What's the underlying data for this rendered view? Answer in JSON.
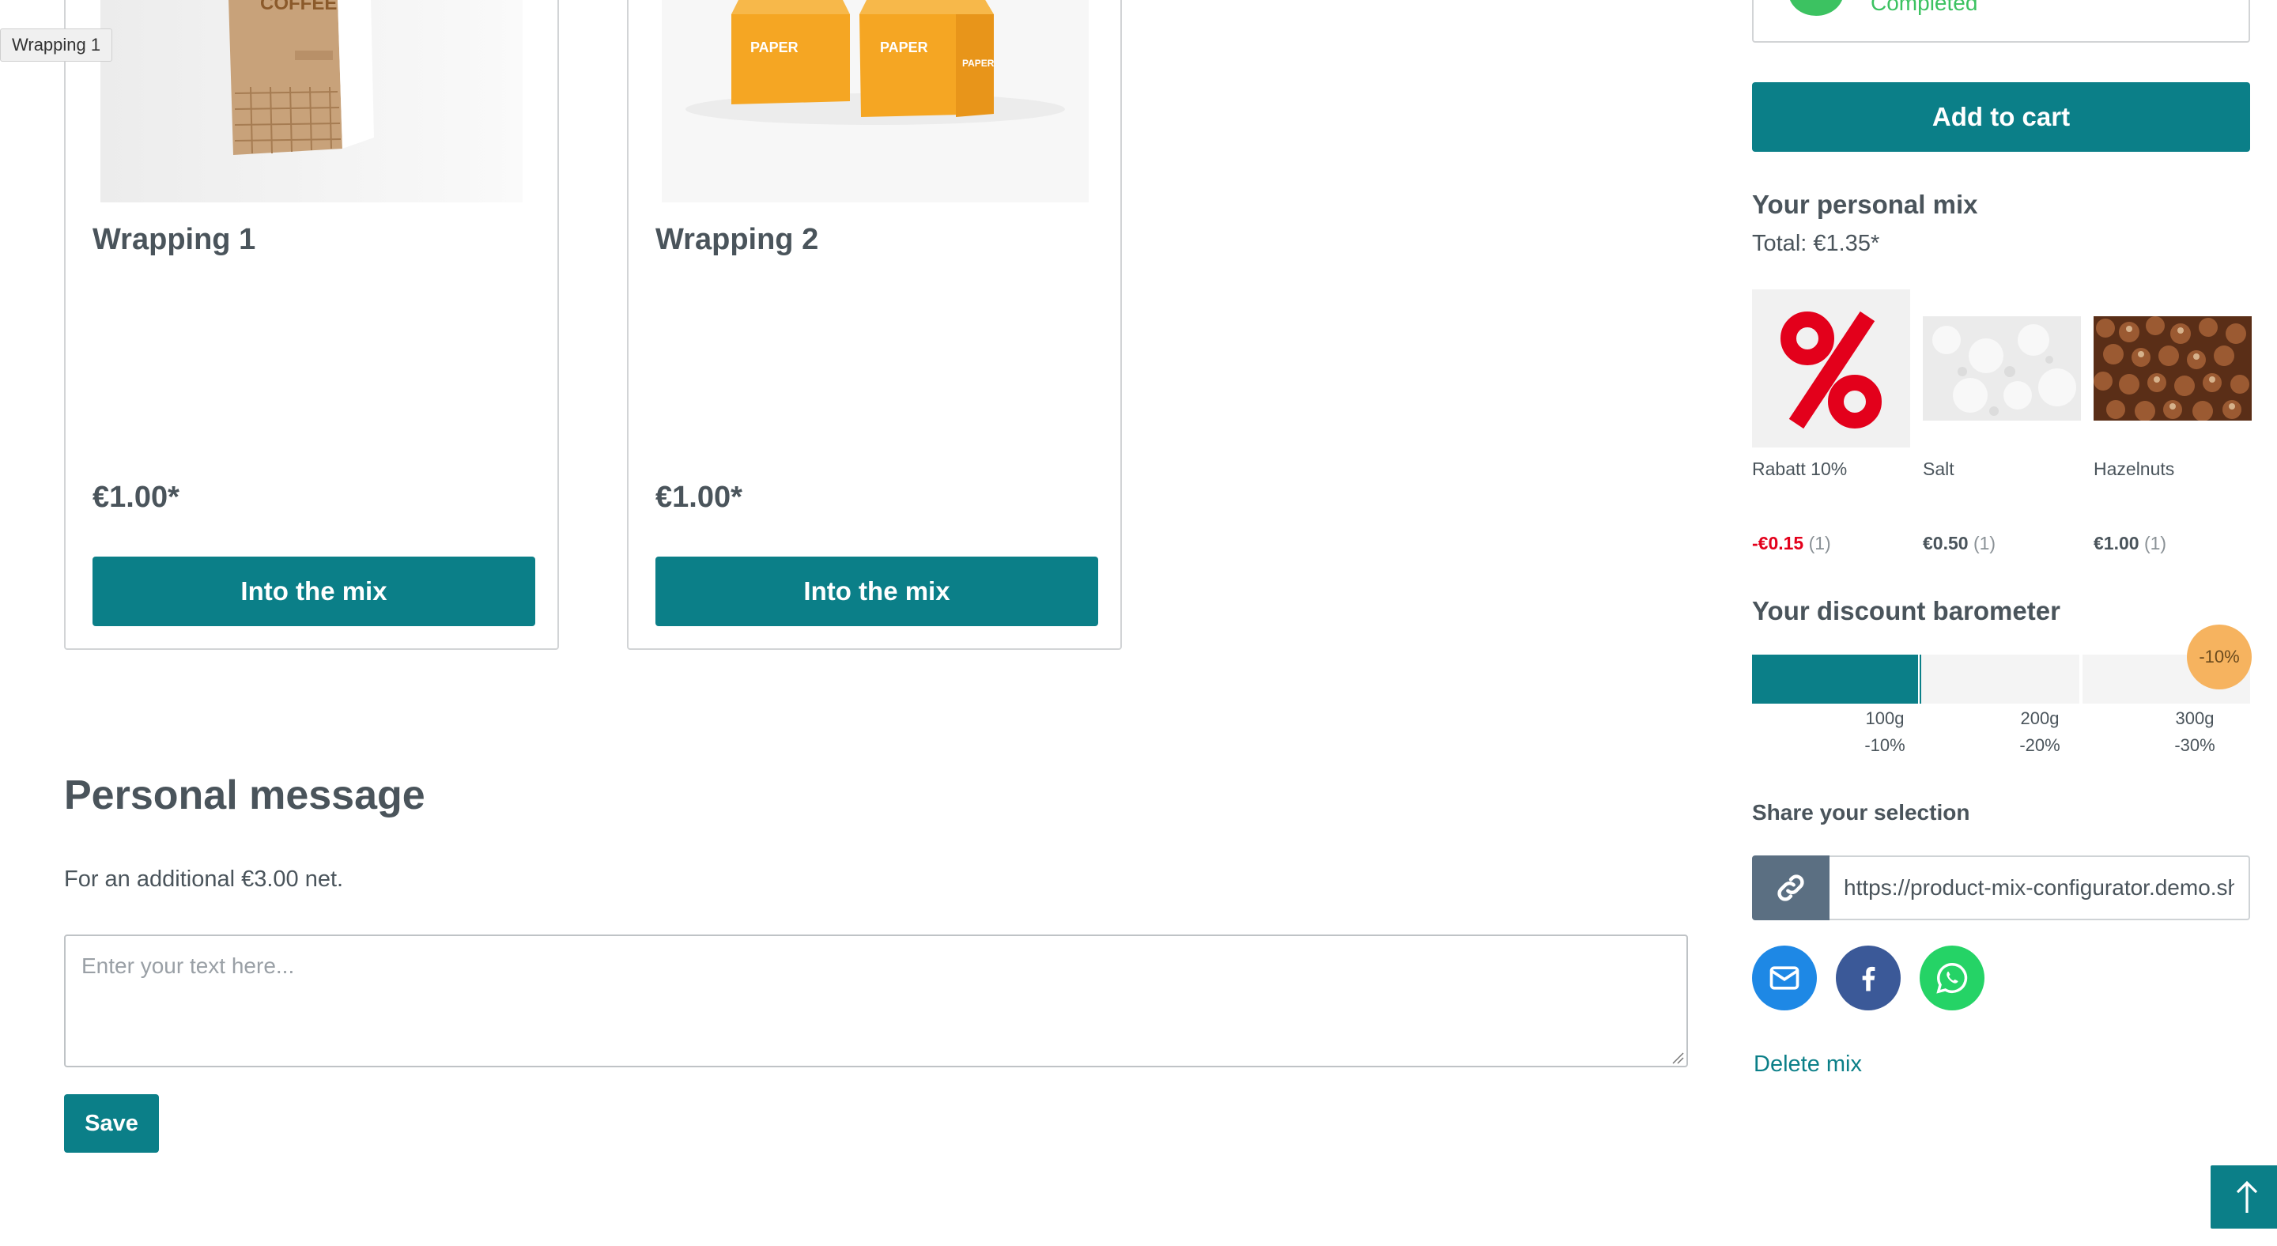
{
  "tooltip": "Wrapping 1",
  "products": [
    {
      "name": "Wrapping 1",
      "price": "€1.00*",
      "button": "Into the mix",
      "image_text": "COFFEE"
    },
    {
      "name": "Wrapping 2",
      "price": "€1.00*",
      "button": "Into the mix",
      "image_text": "PAPER"
    }
  ],
  "personal_message": {
    "title": "Personal message",
    "subtitle": "For an additional €3.00 net.",
    "placeholder": "Enter your text here...",
    "save": "Save"
  },
  "sidebar": {
    "status": "Completed",
    "add_to_cart": "Add to cart",
    "mix_title": "Your personal mix",
    "total": "Total: €1.35*",
    "items": [
      {
        "name": "Rabatt 10%",
        "price": "-€0.15",
        "qty": "(1)",
        "image": "percent-icon"
      },
      {
        "name": "Salt",
        "price": "€0.50",
        "qty": "(1)",
        "image": "salt-image"
      },
      {
        "name": "Hazelnuts",
        "price": "€1.00",
        "qty": "(1)",
        "image": "hazelnuts-image"
      }
    ],
    "barometer": {
      "title": "Your discount barometer",
      "badge": "-10%",
      "fill_fraction": 0.34,
      "steps": [
        {
          "weight": "100g",
          "discount": "-10%"
        },
        {
          "weight": "200g",
          "discount": "-20%"
        },
        {
          "weight": "300g",
          "discount": "-30%"
        }
      ]
    },
    "share": {
      "title": "Share your selection",
      "url": "https://product-mix-configurator.demo.shopware.store",
      "channels": [
        "email-icon",
        "facebook-icon",
        "whatsapp-icon"
      ]
    },
    "delete": "Delete mix"
  },
  "colors": {
    "accent": "#0b7f88",
    "discount": "#e3001b",
    "success": "#3cc261"
  }
}
